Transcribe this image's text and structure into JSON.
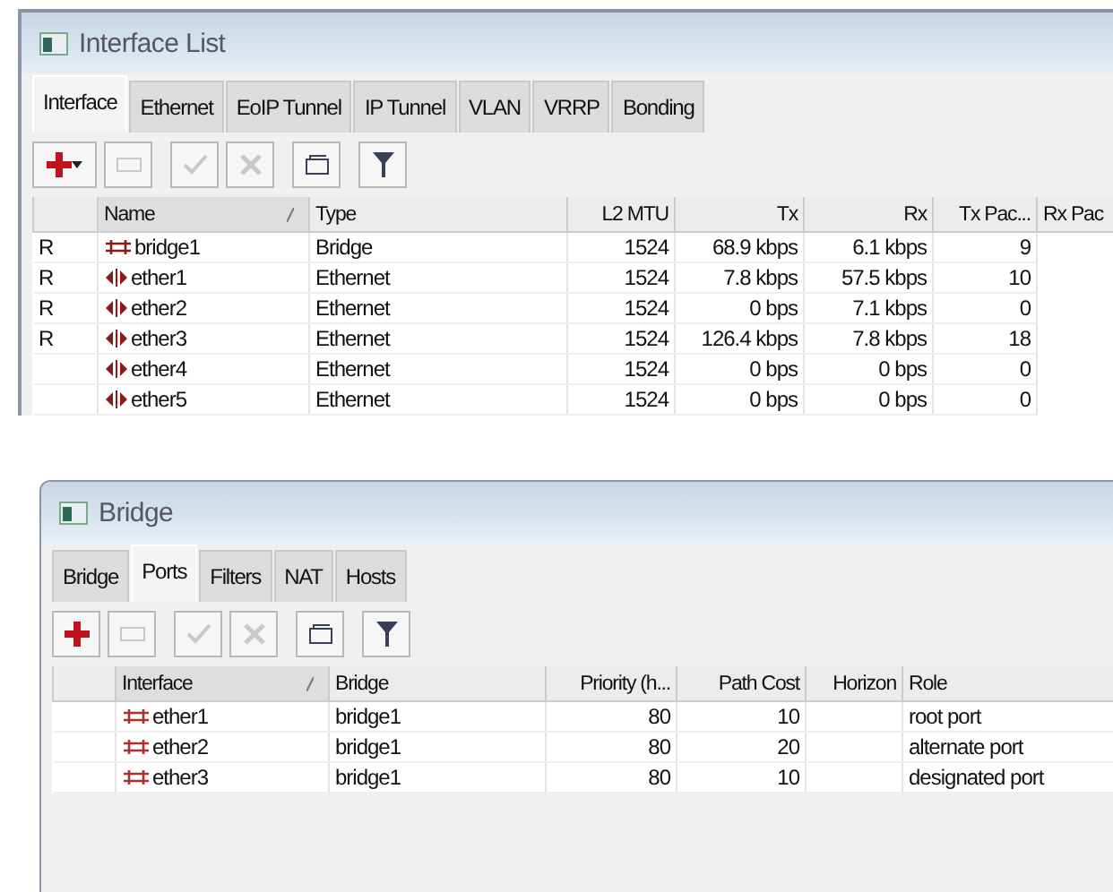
{
  "interface_window": {
    "title": "Interface List",
    "tabs": [
      {
        "label": "Interface",
        "selected": true
      },
      {
        "label": "Ethernet",
        "selected": false
      },
      {
        "label": "EoIP Tunnel",
        "selected": false
      },
      {
        "label": "IP Tunnel",
        "selected": false
      },
      {
        "label": "VLAN",
        "selected": false
      },
      {
        "label": "VRRP",
        "selected": false
      },
      {
        "label": "Bonding",
        "selected": false
      }
    ],
    "toolbar": [
      {
        "kind": "add",
        "disabled": false,
        "dropdown": true
      },
      {
        "kind": "remove",
        "disabled": true
      },
      {
        "kind": "enable",
        "disabled": true
      },
      {
        "kind": "disable",
        "disabled": true
      },
      {
        "kind": "comment",
        "disabled": false
      },
      {
        "kind": "filter",
        "disabled": false
      }
    ],
    "table": {
      "columns": [
        {
          "label": "Name",
          "sorted": true
        },
        {
          "label": "Type",
          "sorted": false
        },
        {
          "label": "L2 MTU",
          "sorted": false
        },
        {
          "label": "Tx",
          "sorted": false
        },
        {
          "label": "Rx",
          "sorted": false
        },
        {
          "label": "Tx Pac...",
          "sorted": false
        },
        {
          "label": "Rx Pac",
          "sorted": false
        }
      ],
      "rows": [
        {
          "kind": "bridge",
          "flag": "R",
          "cells": [
            "bridge1",
            "Bridge",
            "1524",
            "68.9 kbps",
            "6.1 kbps",
            "9"
          ]
        },
        {
          "kind": "ethernet",
          "flag": "R",
          "cells": [
            "ether1",
            "Ethernet",
            "1524",
            "7.8 kbps",
            "57.5 kbps",
            "10"
          ]
        },
        {
          "kind": "ethernet",
          "flag": "R",
          "cells": [
            "ether2",
            "Ethernet",
            "1524",
            "0 bps",
            "7.1 kbps",
            "0"
          ]
        },
        {
          "kind": "ethernet",
          "flag": "R",
          "cells": [
            "ether3",
            "Ethernet",
            "1524",
            "126.4 kbps",
            "7.8 kbps",
            "18"
          ]
        },
        {
          "kind": "ethernet",
          "cells": [
            "ether4",
            "Ethernet",
            "1524",
            "0 bps",
            "0 bps",
            "0"
          ]
        },
        {
          "kind": "ethernet",
          "cells": [
            "ether5",
            "Ethernet",
            "1524",
            "0 bps",
            "0 bps",
            "0"
          ]
        }
      ]
    }
  },
  "bridge_window": {
    "title": "Bridge",
    "tabs": [
      {
        "label": "Bridge",
        "selected": false
      },
      {
        "label": "Ports",
        "selected": true
      },
      {
        "label": "Filters",
        "selected": false
      },
      {
        "label": "NAT",
        "selected": false
      },
      {
        "label": "Hosts",
        "selected": false
      }
    ],
    "toolbar": [
      {
        "kind": "add",
        "disabled": false,
        "dropdown": false
      },
      {
        "kind": "remove",
        "disabled": true
      },
      {
        "kind": "enable",
        "disabled": true
      },
      {
        "kind": "disable",
        "disabled": true
      },
      {
        "kind": "comment",
        "disabled": false
      },
      {
        "kind": "filter",
        "disabled": false
      }
    ],
    "table": {
      "columns": [
        {
          "label": "Interface",
          "sorted": true
        },
        {
          "label": "Bridge",
          "sorted": false
        },
        {
          "label": "Priority (h...",
          "sorted": false
        },
        {
          "label": "Path Cost",
          "sorted": false
        },
        {
          "label": "Horizon",
          "sorted": false
        },
        {
          "label": "Role",
          "sorted": false
        }
      ],
      "rows": [
        {
          "kind": "port",
          "cells": [
            "ether1",
            "bridge1",
            "80",
            "10",
            "",
            "root port"
          ]
        },
        {
          "kind": "port",
          "cells": [
            "ether2",
            "bridge1",
            "80",
            "20",
            "",
            "alternate port"
          ]
        },
        {
          "kind": "port",
          "cells": [
            "ether3",
            "bridge1",
            "80",
            "10",
            "",
            "designated port"
          ]
        }
      ]
    }
  }
}
